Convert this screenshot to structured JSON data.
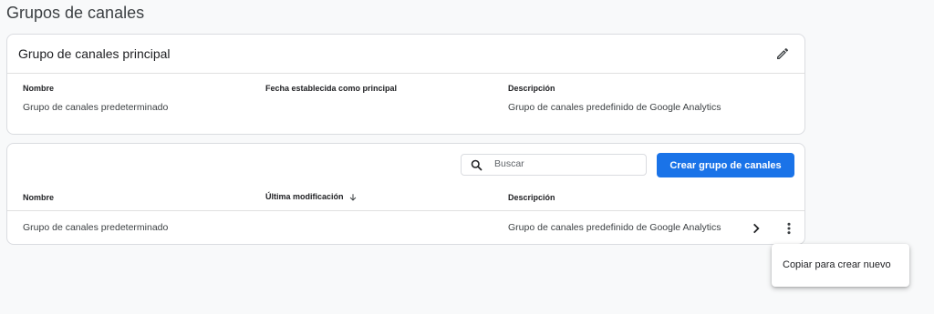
{
  "page": {
    "title": "Grupos de canales"
  },
  "primary_card": {
    "title": "Grupo de canales principal",
    "columns": {
      "name_label": "Nombre",
      "date_label": "Fecha establecida como principal",
      "description_label": "Descripción"
    },
    "values": {
      "name": "Grupo de canales predeterminado",
      "date": "",
      "description": "Grupo de canales predefinido de Google Analytics"
    }
  },
  "list_card": {
    "search": {
      "placeholder": "Buscar"
    },
    "create_button_label": "Crear grupo de canales",
    "headers": {
      "name": "Nombre",
      "modified": "Última modificación",
      "description": "Descripción"
    },
    "rows": [
      {
        "name": "Grupo de canales predeterminado",
        "modified": "",
        "description": "Grupo de canales predefinido de Google Analytics"
      }
    ]
  },
  "context_menu": {
    "items": [
      {
        "label": "Copiar para crear nuevo"
      }
    ]
  },
  "icons": {
    "edit": "pencil-icon",
    "search": "search-icon",
    "sort": "arrow-down-icon",
    "chevron": "chevron-right-icon",
    "more": "more-vert-icon"
  },
  "colors": {
    "primary": "#1a73e8",
    "background": "#f8f9fa"
  }
}
